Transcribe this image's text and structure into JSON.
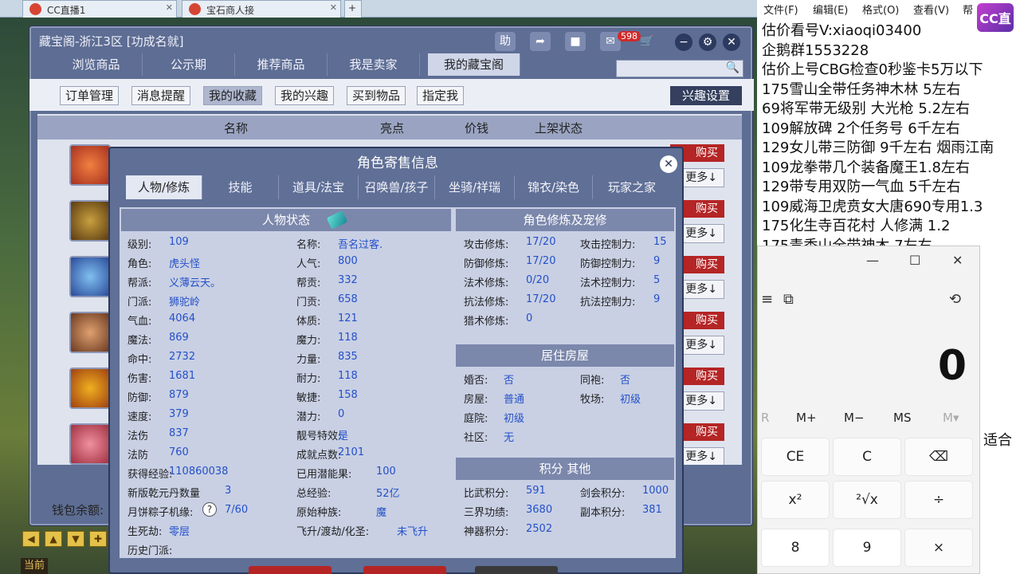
{
  "browser": {
    "tabs": [
      {
        "label": "CC直播1"
      },
      {
        "label": "宝石商人接"
      }
    ]
  },
  "window": {
    "title": "藏宝阁-浙江3区 [功成名就]",
    "help": "助",
    "cart_count": "598"
  },
  "main_tabs": [
    {
      "label": "浏览商品"
    },
    {
      "label": "公示期"
    },
    {
      "label": "推荐商品"
    },
    {
      "label": "我是卖家"
    },
    {
      "label": "我的藏宝阁"
    }
  ],
  "sub_buttons": [
    {
      "label": "订单管理"
    },
    {
      "label": "消息提醒"
    },
    {
      "label": "我的收藏"
    },
    {
      "label": "我的兴趣"
    },
    {
      "label": "买到物品"
    },
    {
      "label": "指定我"
    }
  ],
  "interest_settings": "兴趣设置",
  "list_headers": {
    "name": "名称",
    "highlight": "亮点",
    "price": "价钱",
    "status": "上架状态"
  },
  "row_buttons": {
    "buy": "购买",
    "more": "更多↓"
  },
  "wallet": "钱包余额:",
  "dialog": {
    "title": "角色寄售信息",
    "tabs": [
      {
        "label": "人物/修炼"
      },
      {
        "label": "技能"
      },
      {
        "label": "道具/法宝"
      },
      {
        "label": "召唤兽/孩子"
      },
      {
        "label": "坐骑/祥瑞"
      },
      {
        "label": "锦衣/染色"
      },
      {
        "label": "玩家之家"
      }
    ],
    "status_head": "人物状态",
    "left": [
      [
        "级别:",
        "109"
      ],
      [
        "角色:",
        "虎头怪"
      ],
      [
        "帮派:",
        "义薄云天。"
      ],
      [
        "门派:",
        "狮驼岭"
      ],
      [
        "气血:",
        "4064"
      ],
      [
        "魔法:",
        "869"
      ],
      [
        "命中:",
        "2732"
      ],
      [
        "伤害:",
        "1681"
      ],
      [
        "防御:",
        "879"
      ],
      [
        "速度:",
        "379"
      ],
      [
        "法伤",
        "837"
      ],
      [
        "法防",
        "760"
      ]
    ],
    "mid": [
      [
        "名称:",
        "吾名过客."
      ],
      [
        "人气:",
        "800"
      ],
      [
        "帮贡:",
        "332"
      ],
      [
        "门贡:",
        "658"
      ],
      [
        "体质:",
        "121"
      ],
      [
        "魔力:",
        "118"
      ],
      [
        "力量:",
        "835"
      ],
      [
        "耐力:",
        "118"
      ],
      [
        "敏捷:",
        "158"
      ],
      [
        "潜力:",
        "0"
      ],
      [
        "靓号特效:",
        "是"
      ],
      [
        "成就点数:",
        "2101"
      ]
    ],
    "extra_left": [
      [
        "获得经验:",
        "110860038"
      ],
      [
        "新版乾元丹数量",
        "3"
      ],
      [
        "月饼粽子机缘:",
        "7/60"
      ],
      [
        "生死劫:",
        "零层"
      ],
      [
        "历史门派:",
        ""
      ]
    ],
    "extra_mid": [
      [
        "已用潜能果:",
        "100"
      ],
      [
        "总经验:",
        "52亿"
      ],
      [
        "原始种族:",
        "魔"
      ],
      [
        "飞升/渡劫/化圣:",
        "未飞升"
      ]
    ],
    "cult_head": "角色修炼及宠修",
    "cult_left": [
      [
        "攻击修炼:",
        "17/20"
      ],
      [
        "防御修炼:",
        "17/20"
      ],
      [
        "法术修炼:",
        "0/20"
      ],
      [
        "抗法修炼:",
        "17/20"
      ],
      [
        "猎术修炼:",
        "0"
      ]
    ],
    "cult_right": [
      [
        "攻击控制力:",
        "15"
      ],
      [
        "防御控制力:",
        "9"
      ],
      [
        "法术控制力:",
        "5"
      ],
      [
        "抗法控制力:",
        "9"
      ]
    ],
    "house_head": "居住房屋",
    "house_left": [
      [
        "婚否:",
        "否"
      ],
      [
        "房屋:",
        "普通"
      ],
      [
        "庭院:",
        "初级"
      ],
      [
        "社区:",
        "无"
      ]
    ],
    "house_right": [
      [
        "同袍:",
        "否"
      ],
      [
        "牧场:",
        "初级"
      ]
    ],
    "score_head": "积分 其他",
    "score_left": [
      [
        "比武积分:",
        "591"
      ],
      [
        "三界功绩:",
        "3680"
      ],
      [
        "神器积分:",
        "2502"
      ]
    ],
    "score_right": [
      [
        "剑会积分:",
        "1000"
      ],
      [
        "副本积分:",
        "381"
      ]
    ]
  },
  "hud": {
    "current": "当前"
  },
  "notepad": {
    "menu": [
      {
        "label": "文件(F)"
      },
      {
        "label": "编辑(E)"
      },
      {
        "label": "格式(O)"
      },
      {
        "label": "查看(V)"
      },
      {
        "label": "帮"
      }
    ],
    "logo": "CC直播",
    "lines": [
      "估价看号V:xiaoqi03400",
      "企鹅群1553228",
      "估价上号CBG检查0秒鉴卡5万以下",
      "175雪山全带任务神木林 5左右",
      "69将军带无级别 大光枪 5.2左右",
      "109解放碑 2个任务号 6千左右",
      "129女儿带三防御 9千左右 烟雨江南",
      "109龙拳带几个装备魔王1.8左右",
      "129带专用双防一气血 5千左右",
      "109威海卫虎贲女大唐690专用1.3",
      "175化生寺百花村 人修满 1.2",
      "175青香山全带神木 7左右"
    ],
    "peek": "适合"
  },
  "calculator": {
    "display": "0",
    "memory": [
      {
        "label": "R"
      },
      {
        "label": "M+"
      },
      {
        "label": "M−"
      },
      {
        "label": "MS"
      },
      {
        "label": "M▾"
      }
    ],
    "keys": [
      {
        "label": "CE"
      },
      {
        "label": "C"
      },
      {
        "label": "⌫"
      },
      {
        "label": "x²"
      },
      {
        "label": "²√x"
      },
      {
        "label": "÷"
      },
      {
        "label": "8"
      },
      {
        "label": "9"
      },
      {
        "label": "×"
      }
    ]
  }
}
